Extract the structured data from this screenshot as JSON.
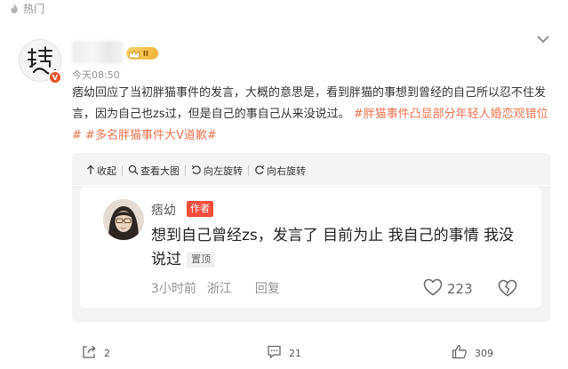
{
  "section": {
    "label": "热门",
    "icon": "fire-icon"
  },
  "post": {
    "time": "今天08:50",
    "vip_level": "II",
    "avatar_verified_mark": "V",
    "text_plain": "痞幼回应了当初胖猫事件的发言，大概的意思是，看到胖猫的事想到曾经的自己所以忍不住发言，因为自己也zs过，但是自己的事自己从来没说过。",
    "hashtag_1": "#胖猫事件凸显部分年轻人婚恋观错位#",
    "hashtag_2": "#多名胖猫事件大V道歉#"
  },
  "image_toolbar": {
    "collapse": "收起",
    "view_large": "查看大图",
    "rotate_left": "向左旋转",
    "rotate_right": "向右旋转"
  },
  "comment": {
    "username": "痞幼",
    "author_badge": "作者",
    "text": "想到自己曾经zs，发言了 目前为止 我自己的事情 我没说过",
    "pinned_badge": "置顶",
    "time": "3小时前",
    "location": "浙江",
    "reply_label": "回复",
    "like_count": "223"
  },
  "actions": {
    "repost_count": "2",
    "comment_count": "21",
    "like_count": "309"
  },
  "colors": {
    "hashtag": "#eb7350",
    "author_badge": "#f34c3d",
    "card_background": "#f4f4f4",
    "vip_badge": "#f2b43a"
  }
}
